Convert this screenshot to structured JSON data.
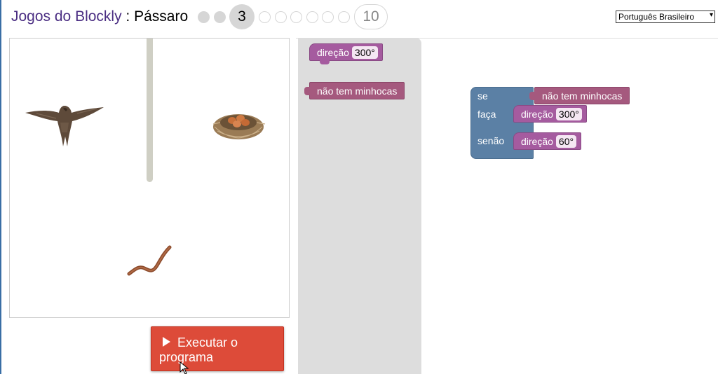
{
  "header": {
    "app_title": "Jogos do Blockly",
    "separator": " : ",
    "game_name": "Pássaro",
    "current_level": "3",
    "last_level": "10",
    "language": "Português Brasileiro"
  },
  "levels": {
    "completed": 2,
    "current": 3,
    "total": 10
  },
  "run_button": {
    "label": "Executar o programa"
  },
  "toolbox": {
    "heading_block": {
      "label": "direção",
      "value": "300°"
    },
    "condition_block": {
      "label": "não tem minhocas"
    }
  },
  "program": {
    "if_label": "se",
    "do_label": "faça",
    "else_label": "senão",
    "condition": "não tem minhocas",
    "do_heading": {
      "label": "direção",
      "value": "300°"
    },
    "else_heading": {
      "label": "direção",
      "value": "60°"
    }
  },
  "colors": {
    "title_brand": "#4b2e83",
    "run_button": "#dd4b39",
    "heading_block": "#a55b9f",
    "condition_block": "#a5597e",
    "logic_block": "#5b80a5",
    "flyout": "#dddddd",
    "wall": "#cfcfc4"
  }
}
